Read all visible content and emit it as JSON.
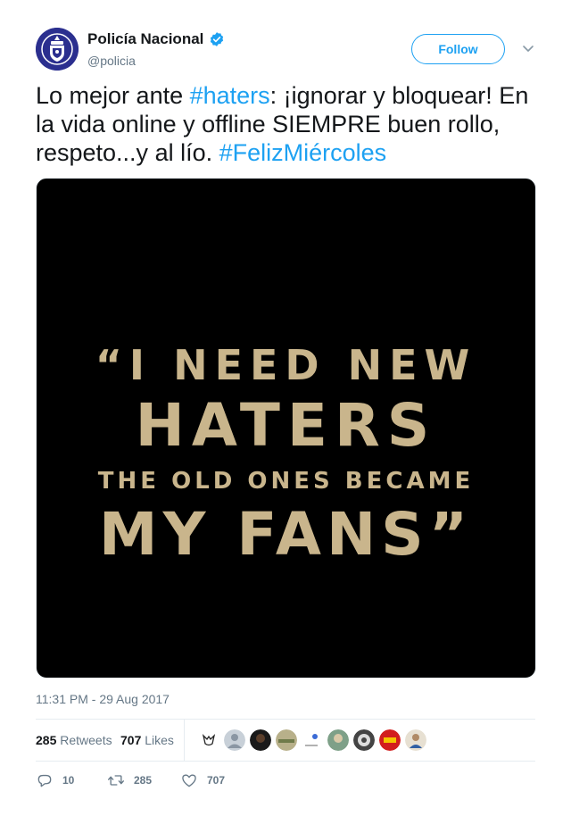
{
  "author": {
    "display_name": "Policía Nacional",
    "handle": "@policia",
    "verified": true,
    "avatar_icon": "police-badge-icon"
  },
  "follow_label": "Follow",
  "tweet": {
    "segments": [
      {
        "text": "Lo mejor ante ",
        "type": "text"
      },
      {
        "text": "#haters",
        "type": "hashtag"
      },
      {
        "text": ": ¡ignorar y bloquear! En la vida online y offline SIEMPRE buen rollo, respeto...y al lío. ",
        "type": "text"
      },
      {
        "text": "#FelizMiércoles",
        "type": "hashtag"
      }
    ]
  },
  "media": {
    "quote_lines": [
      "“I NEED NEW",
      "HATERS",
      "THE OLD ONES BECAME",
      "MY FANS”"
    ]
  },
  "timestamp": "11:31 PM - 29 Aug 2017",
  "stats": {
    "retweets_count": "285",
    "retweets_label": "Retweets",
    "likes_count": "707",
    "likes_label": "Likes"
  },
  "actions": {
    "reply_count": "10",
    "retweet_count": "285",
    "like_count": "707"
  },
  "colors": {
    "link": "#1da1f2",
    "secondary_text": "#657786",
    "quote_gold": "#c9b58c"
  }
}
